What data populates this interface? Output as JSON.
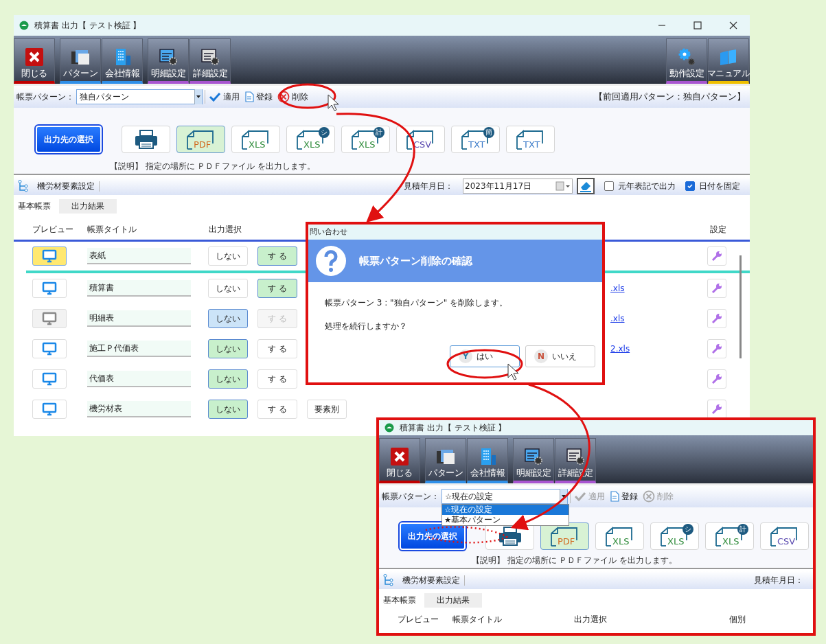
{
  "windows": [
    {
      "title": "積算書 出力【 テスト検証 】",
      "toolbar": [
        {
          "label": "閉じる",
          "kind": "close"
        },
        {
          "label": "パターン",
          "kind": "pattern"
        },
        {
          "label": "会社情報",
          "kind": "company"
        },
        {
          "label": "明細設定",
          "kind": "detail"
        },
        {
          "label": "詳細設定",
          "kind": "advanced"
        }
      ],
      "toolbar_right": [
        {
          "label": "動作設定",
          "kind": "gear"
        },
        {
          "label": "マニュアル",
          "kind": "manual"
        }
      ],
      "pattern_bar": {
        "label": "帳票パターン：",
        "value": "独自パターン",
        "actions": [
          {
            "label": "適用",
            "kind": "apply",
            "disabled": false
          },
          {
            "label": "登録",
            "kind": "register",
            "disabled": false
          },
          {
            "label": "削除",
            "kind": "delete",
            "disabled": false
          }
        ],
        "previous": "【前回適用パターン：独自パターン】"
      },
      "select_button": "出力先の選択",
      "formats": [
        {
          "kind": "printer",
          "selected": false
        },
        {
          "kind": "file",
          "label": "PDF",
          "color": "#d2691e",
          "selected": true
        },
        {
          "kind": "file",
          "label": "XLS",
          "color": "#2e8b3a",
          "selected": false
        },
        {
          "kind": "file",
          "label": "XLS",
          "badge": "シ",
          "color": "#2e8b3a",
          "selected": false
        },
        {
          "kind": "file",
          "label": "XLS",
          "badge": "計",
          "color": "#2e8b3a",
          "selected": false
        },
        {
          "kind": "file",
          "label": "CSV",
          "color": "#5b4bb0",
          "selected": false
        },
        {
          "kind": "file",
          "label": "TXT",
          "badge": "簡",
          "color": "#3a7ac8",
          "selected": false
        },
        {
          "kind": "file",
          "label": "TXT",
          "color": "#3a7ac8",
          "selected": false
        }
      ],
      "description": "【説明】 指定の場所に ＰＤＦファイル を出力します。",
      "section": {
        "label": "機労材要素設定",
        "date_label": "見積年月日：",
        "date": "2023年11月17日",
        "options": [
          {
            "label": "元年表記で出力",
            "checked": false
          },
          {
            "label": "日付を固定",
            "checked": true
          }
        ]
      },
      "tabs": [
        {
          "label": "基本帳票",
          "selected": true
        },
        {
          "label": "出力結果",
          "selected": false
        }
      ],
      "table": {
        "columns": [
          {
            "label": "プレビュー",
            "kind": "preview"
          },
          {
            "label": "帳票タイトル",
            "kind": "title"
          },
          {
            "label": "出力選択",
            "kind": "output"
          },
          {
            "label": "設定",
            "kind": "settings"
          }
        ],
        "rows": [
          {
            "title": "表紙",
            "selected": true,
            "disabled": false,
            "choices": [
              {
                "label": "しない",
                "selected": false
              },
              {
                "label": "す る",
                "selected": true
              }
            ]
          },
          {
            "title": "積算書",
            "selected": false,
            "disabled": false,
            "choices": [
              {
                "label": "しない",
                "selected": false
              },
              {
                "label": "す る",
                "selected": true
              }
            ],
            "link": ".xls"
          },
          {
            "title": "明細表",
            "selected": false,
            "disabled": true,
            "choices": [
              {
                "label": "しない",
                "selected": true
              },
              {
                "label": "す る",
                "selected": false
              }
            ],
            "link": ".xls"
          },
          {
            "title": "施工Ｐ代価表",
            "selected": false,
            "disabled": false,
            "choices": [
              {
                "label": "しない",
                "selected": true
              },
              {
                "label": "す る",
                "selected": false
              }
            ],
            "link": "2.xls"
          },
          {
            "title": "代価表",
            "selected": false,
            "disabled": false,
            "choices": [
              {
                "label": "しない",
                "selected": true
              },
              {
                "label": "す る",
                "selected": false
              }
            ]
          },
          {
            "title": "機労材表",
            "selected": false,
            "disabled": false,
            "choices": [
              {
                "label": "しない",
                "selected": true
              },
              {
                "label": "す る",
                "selected": false
              }
            ],
            "column_4": "要素別"
          }
        ]
      }
    },
    {
      "title": "積算書 出力【 テスト検証 】",
      "toolbar": [
        {
          "label": "閉じる",
          "kind": "close"
        },
        {
          "label": "パターン",
          "kind": "pattern"
        },
        {
          "label": "会社情報",
          "kind": "company"
        },
        {
          "label": "明細設定",
          "kind": "detail"
        },
        {
          "label": "詳細設定",
          "kind": "advanced"
        }
      ],
      "pattern_bar": {
        "label": "帳票パターン：",
        "value": "☆現在の設定",
        "options": [
          {
            "label": "☆現在の設定",
            "selected": true
          },
          {
            "label": "★基本パターン",
            "selected": false
          }
        ],
        "actions": [
          {
            "label": "適用",
            "kind": "apply",
            "disabled": true
          },
          {
            "label": "登録",
            "kind": "register",
            "disabled": false
          },
          {
            "label": "削除",
            "kind": "delete",
            "disabled": true
          }
        ]
      },
      "select_button": "出力先の選択",
      "formats": [
        {
          "kind": "printer",
          "selected": false
        },
        {
          "kind": "file",
          "label": "PDF",
          "color": "#d2691e",
          "selected": true
        },
        {
          "kind": "file",
          "label": "XLS",
          "color": "#2e8b3a",
          "selected": false
        },
        {
          "kind": "file",
          "label": "XLS",
          "badge": "シ",
          "color": "#2e8b3a",
          "selected": false
        },
        {
          "kind": "file",
          "label": "XLS",
          "badge": "計",
          "color": "#2e8b3a",
          "selected": false
        },
        {
          "kind": "file",
          "label": "CSV",
          "color": "#5b4bb0",
          "selected": false
        }
      ],
      "description": "【説明】 指定の場所に ＰＤＦファイル を出力します。",
      "section": {
        "label": "機労材要素設定",
        "date_label": "見積年月日："
      },
      "tabs": [
        {
          "label": "基本帳票",
          "selected": true
        },
        {
          "label": "出力結果",
          "selected": false
        }
      ],
      "table": {
        "columns": [
          {
            "label": "プレビュー",
            "kind": "preview"
          },
          {
            "label": "帳票タイトル",
            "kind": "title"
          },
          {
            "label": "出力選択",
            "kind": "output"
          },
          {
            "label": "個別",
            "kind": "individual"
          }
        ]
      }
    }
  ],
  "dialog": {
    "caption": "問い合わせ",
    "title": "帳票パターン削除の確認",
    "lines": [
      "帳票パターン 3 : \"独自パターン\" を削除します。",
      "処理を続行しますか？"
    ],
    "buttons": [
      {
        "label": "はい",
        "key": "Y",
        "kind": "yes"
      },
      {
        "label": "いいえ",
        "key": "N",
        "kind": "no"
      }
    ]
  }
}
